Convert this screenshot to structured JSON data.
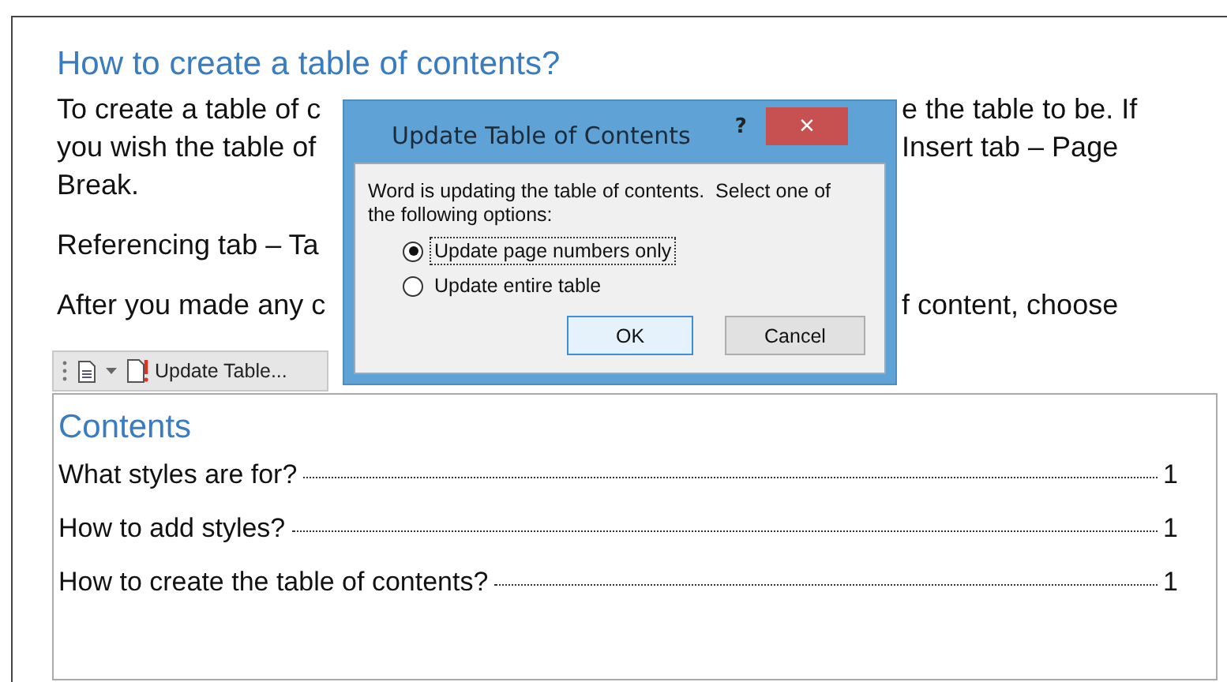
{
  "document": {
    "heading": "How to create a table of contents?",
    "paragraphs": [
      [
        {
          "left": "To create a table of c",
          "right": "e the table to be. If"
        },
        {
          "left": "you wish the table of",
          "right": "Insert tab – Page"
        },
        {
          "left": "Break."
        }
      ],
      [
        {
          "left": "Referencing tab – Ta"
        }
      ],
      [
        {
          "left": "After you made any c",
          "right": "f content, choose"
        }
      ]
    ]
  },
  "toc_toolbar": {
    "label": "Update Table..."
  },
  "contents": {
    "title": "Contents",
    "entries": [
      {
        "title": "What styles are for?",
        "page": "1"
      },
      {
        "title": "How to add styles?",
        "page": "1"
      },
      {
        "title": "How to create the table of contents?",
        "page": "1"
      }
    ]
  },
  "dialog": {
    "title": "Update Table of Contents",
    "help": "?",
    "close": "×",
    "message": "Word is updating the table of contents.  Select one of the following options:",
    "options": [
      {
        "label": "Update page numbers only",
        "selected": true,
        "focused": true
      },
      {
        "label": "Update entire table",
        "selected": false,
        "focused": false
      }
    ],
    "buttons": [
      {
        "label": "OK",
        "default": true
      },
      {
        "label": "Cancel",
        "default": false
      }
    ]
  }
}
